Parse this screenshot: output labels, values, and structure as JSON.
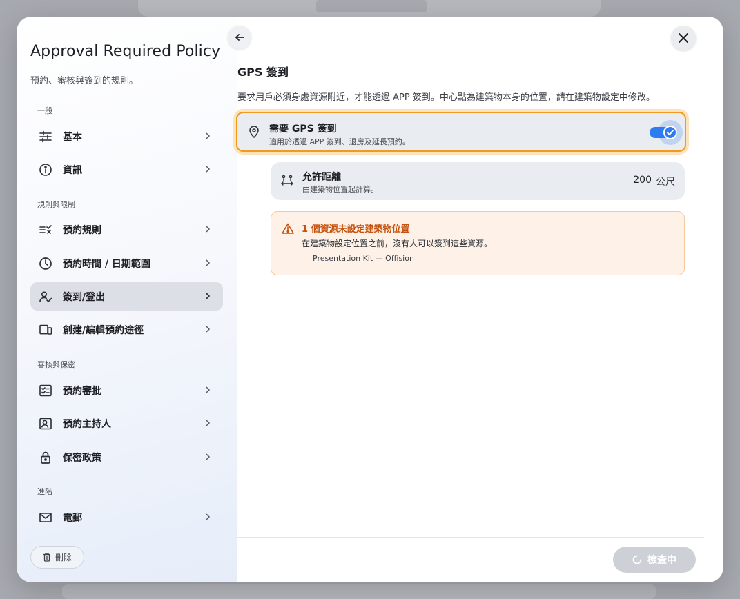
{
  "sidebar": {
    "title": "Approval Required Policy",
    "subtitle": "預約、審核與簽到的規則。",
    "sections": {
      "general": "一般",
      "rules": "規則與限制",
      "approval": "審核與保密",
      "advanced": "進階"
    },
    "items": [
      {
        "label": "基本",
        "icon": "sliders-icon"
      },
      {
        "label": "資訊",
        "icon": "info-icon"
      },
      {
        "label": "預約規則",
        "icon": "rules-icon"
      },
      {
        "label": "預約時間 / 日期範圍",
        "icon": "clock-icon"
      },
      {
        "label": "簽到/登出",
        "icon": "person-check-icon",
        "active": true
      },
      {
        "label": "創建/編輯預約途徑",
        "icon": "devices-icon"
      },
      {
        "label": "預約審批",
        "icon": "checklist-icon"
      },
      {
        "label": "預約主持人",
        "icon": "host-icon"
      },
      {
        "label": "保密政策",
        "icon": "lock-icon"
      },
      {
        "label": "電郵",
        "icon": "mail-icon"
      }
    ],
    "delete_label": "刪除"
  },
  "main": {
    "title": "GPS 簽到",
    "description": "要求用戶必須身處資源附近，才能透過 APP 簽到。中心點為建築物本身的位置，請在建築物設定中修改。",
    "gps_toggle": {
      "title": "需要 GPS 簽到",
      "subtitle": "適用於透過 APP 簽到、退房及延長預約。",
      "enabled": true
    },
    "distance": {
      "title": "允許距離",
      "subtitle": "由建築物位置起計算。",
      "value": "200",
      "unit": "公尺"
    },
    "warning": {
      "title": "1 個資源未設定建築物位置",
      "message": "在建築物設定位置之前，沒有人可以簽到這些資源。",
      "resource": "Presentation Kit — Offision"
    },
    "check_button": "檢查中"
  },
  "colors": {
    "accent": "#2f7cf0",
    "highlight_border": "#f29a1f",
    "warning_text": "#c5520d",
    "warning_bg": "#fdf1e8"
  }
}
